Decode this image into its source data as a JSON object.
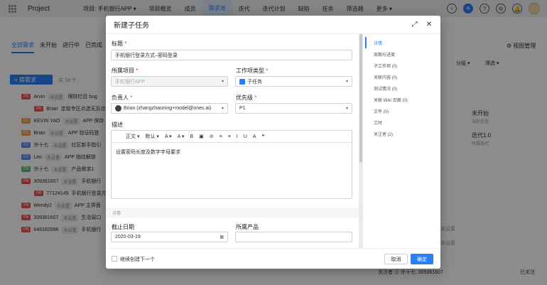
{
  "topbar": {
    "project": "Project",
    "nav": [
      "项目: 手机银行APP ▾",
      "项目概览",
      "成员",
      "需求池",
      "迭代",
      "迭代计划",
      "缺陷",
      "任务",
      "筛选器",
      "更多 ▾"
    ],
    "active_nav": 3
  },
  "bg": {
    "tabs": [
      "全部需求",
      "未开始",
      "进行中",
      "已完成"
    ],
    "new_button": "提需求",
    "count": "共 13 个",
    "rows": [
      {
        "p": "P0",
        "user": "Arvin",
        "tag": "未设置",
        "title": "理财栏目 bug",
        "cls": "b-red"
      },
      {
        "p": "P6",
        "user": "Brian",
        "tag": "",
        "title": "定投专区点选无反应",
        "cls": "b-red"
      },
      {
        "p": "P1",
        "user": "KEVIN YAO",
        "tag": "未设置",
        "title": "APP 保存",
        "cls": "b-orange"
      },
      {
        "p": "P1",
        "user": "Brian",
        "tag": "未设置",
        "title": "APP 验证码登",
        "cls": "b-orange"
      },
      {
        "p": "P2",
        "user": "许十七",
        "tag": "未设置",
        "title": "社区新手指引",
        "cls": "b-blue"
      },
      {
        "p": "P2",
        "user": "Leo",
        "tag": "未设置",
        "title": "APP 指纹解锁",
        "cls": "b-blue"
      },
      {
        "p": "P3",
        "user": "许十七",
        "tag": "未设置",
        "title": "产品需求1",
        "cls": "b-green"
      },
      {
        "p": "P6",
        "user": "309361607",
        "tag": "未设置",
        "title": "手机银行",
        "cls": "b-red"
      },
      {
        "p": "P6",
        "user": "77124145",
        "tag": "",
        "title": "手机银行登录方",
        "cls": "b-red"
      },
      {
        "p": "P6",
        "user": "Wendy2",
        "tag": "未设置",
        "title": "APP 主界面",
        "cls": "b-red"
      },
      {
        "p": "P6",
        "user": "309361607",
        "tag": "未设置",
        "title": "生活窗口",
        "cls": "b-red"
      },
      {
        "p": "P6",
        "user": "646160596",
        "tag": "未设置",
        "title": "手机银行",
        "cls": "b-red"
      }
    ],
    "right_top": "视图管理",
    "right_group": "分组 ▾",
    "right_filter": "筛选 ▾",
    "status": "未开始",
    "status_sub": "当前状态",
    "iteration": "迭代1.0",
    "iteration_sub": "所属迭代",
    "unset_1": "未设置",
    "unset_2": "未设置",
    "watchers": "关注者 ②  许十七, 309361607",
    "watched": "已关注"
  },
  "modal": {
    "title": "新建子任务",
    "title_label": "标题",
    "title_value": "手机银行登录方式–密码登录",
    "project_label": "所属项目",
    "project_value": "手机银行APP",
    "type_label": "工作项类型",
    "type_value": "子任务",
    "owner_label": "负责人",
    "owner_value": "Brian (zhangzhaoning+model@ones.ai)",
    "priority_label": "优先级",
    "priority_value": "P1",
    "desc_label": "描述",
    "toolbar": [
      "正文 ▾",
      "默认 ▾",
      "A ▾",
      "A ▾",
      "B",
      "▣",
      "⊘",
      "≡",
      "≡",
      "I",
      "U",
      "A",
      "❝"
    ],
    "desc_value": "设置密码长度及数字字母要求",
    "section": "详情",
    "due_label": "截止日期",
    "due_value": "2020-03-19",
    "product_label": "所属产品",
    "product_value": "",
    "sidebar": [
      "详情",
      "周期与进度",
      "子工作项 (0)",
      "关联内容 (0)",
      "测试情况 (0)",
      "关联 Wiki 页面 (0)",
      "文件 (0)",
      "工时",
      "关注者 (2)"
    ],
    "continue_label": "继续创建下一个",
    "cancel": "取消",
    "ok": "确定"
  }
}
